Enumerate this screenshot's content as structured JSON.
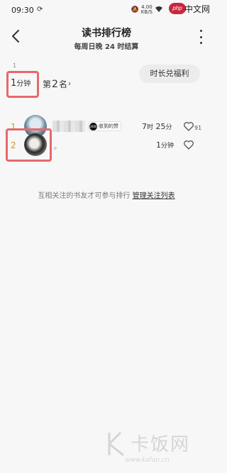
{
  "status": {
    "time": "09:30",
    "speed_value": "4.00",
    "speed_unit": "KB/S"
  },
  "overlay": {
    "php_logo": "php",
    "php_zh": "中文网"
  },
  "header": {
    "title": "读书排行榜",
    "subtitle": "每周日晚 24 时结算"
  },
  "summary": {
    "rank_small": "1",
    "my_time_value": "1",
    "my_time_unit": "分钟",
    "rank_prefix": "第",
    "rank_value": "2",
    "rank_suffix": "名",
    "redeem_label": "时长兑福利"
  },
  "list": [
    {
      "rank": "1",
      "badge_logo": "2600",
      "badge_text": "收到的赞",
      "time_h": "7",
      "time_h_unit": "时",
      "time_m": "25",
      "time_m_unit": "分",
      "likes": "91"
    },
    {
      "rank": "2",
      "name": "。",
      "time_m": "1",
      "time_m_unit": "分钟"
    }
  ],
  "footer": {
    "note": "互相关注的书友才可参与排行",
    "link": "管理关注列表"
  },
  "watermark": {
    "text": "卡饭网",
    "url": "www.kafan.cn"
  },
  "colors": {
    "highlight": "#e8686a",
    "rank_gold": "#c99a2e",
    "background": "#f7f7f7"
  }
}
